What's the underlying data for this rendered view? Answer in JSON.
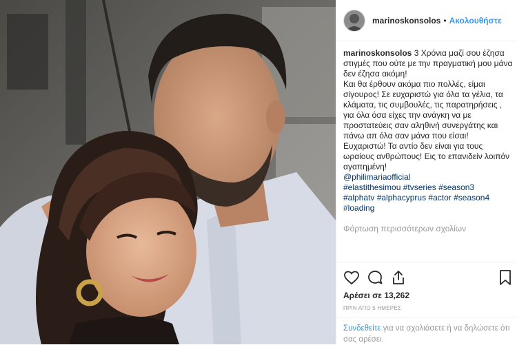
{
  "post": {
    "username": "marinoskonsolos",
    "dot": "•",
    "follow_label": "Ακολουθήστε"
  },
  "caption": {
    "username": "marinoskonsolos",
    "line1": "3 Χρόνια μαζί σου έζησα στιγμές που ούτε με την πραγματική μου μάνα δεν έζησα ακόμη!",
    "line2": "Και θα έρθουν ακόμα πιο πολλές, είμαι σίγουρος! Σε ευχαριστώ για όλα τα γέλια, τα κλάματα, τις συμβουλές, τις παρατηρήσεις , για όλα όσα είχες την ανάγκη να με προστατεύεις σαν αληθινή συνεργάτης και πάνω απ όλα σαν μάνα που είσαι! Ευχαριστώ! Τα αντίο δεν είναι για τους ωραίους ανθρώπους! Εις το επανιδείν λοιπόν αγαπημένη!",
    "mention": "@philimariaofficial",
    "hashtags1": "#elastithesimou #tvseries #season3",
    "hashtags2": "#alphatv #alphacyprus #actor #season4",
    "hashtags3": "#loading"
  },
  "comments": {
    "load_more": "Φόρτωση περισσότερων σχολίων"
  },
  "actions": {
    "icons": [
      "heart-icon",
      "comment-icon",
      "share-icon",
      "bookmark-icon"
    ],
    "likes_text": "Αρέσει σε 13,262",
    "timestamp": "ΠΡΙΝ ΑΠΟ 5 ΗΜΕΡΕΣ"
  },
  "login": {
    "link": "Συνδεθείτε",
    "text": "για να σχολιάσετε ή να δηλώσετε ότι σας αρέσει."
  },
  "colors": {
    "link_blue": "#3897f0",
    "hashtag_blue": "#003569",
    "muted": "#999999",
    "text": "#262626"
  }
}
